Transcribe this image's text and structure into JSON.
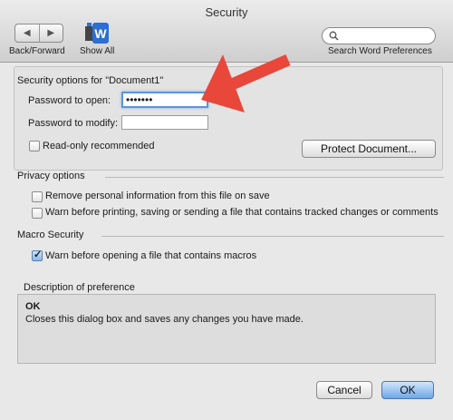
{
  "window": {
    "title": "Security"
  },
  "toolbar": {
    "back_forward_label": "Back/Forward",
    "show_all_label": "Show All",
    "search_placeholder": "",
    "search_caption": "Search Word Preferences"
  },
  "security": {
    "section_title": "Security options for \"Document1\"",
    "password_open_label": "Password to open:",
    "password_open_value": "•••••••",
    "password_modify_label": "Password to modify:",
    "password_modify_value": "",
    "readonly_label": "Read-only recommended",
    "readonly_checked": false,
    "protect_button": "Protect Document..."
  },
  "privacy": {
    "section_title": "Privacy options",
    "items": [
      {
        "label": "Remove personal information from this file on save",
        "checked": false
      },
      {
        "label": "Warn before printing, saving or sending a file that contains tracked changes or comments",
        "checked": false
      }
    ]
  },
  "macro": {
    "section_title": "Macro Security",
    "items": [
      {
        "label": "Warn before opening a file that contains macros",
        "checked": true
      }
    ]
  },
  "description": {
    "section_title": "Description of preference",
    "heading": "OK",
    "text": "Closes this dialog box and saves any changes you have made."
  },
  "buttons": {
    "cancel": "Cancel",
    "ok": "OK"
  },
  "colors": {
    "arrow": "#e8473a",
    "focus": "#5b95d8",
    "default_button": "#6fa7e6"
  }
}
